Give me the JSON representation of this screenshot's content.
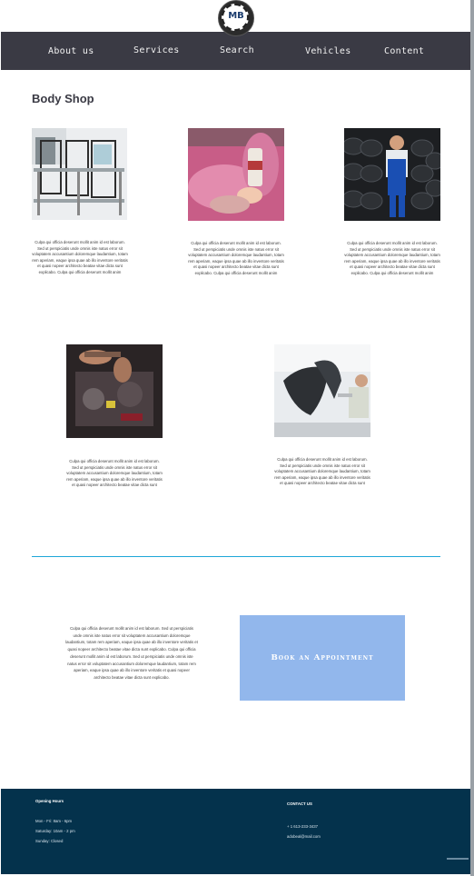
{
  "header": {
    "logo_text": "MB",
    "nav": [
      "About us",
      "Services",
      "Search",
      "Vehicles",
      "Content"
    ]
  },
  "main": {
    "title": "Body Shop",
    "cards": [
      {
        "image": "door-frame-jig",
        "caption": "Culpa qui officia deserunt mollit anim id est laborum. Sed ut perspiciatis unde omnis iste natus error sit voluptatem accusantium doloremque laudantium, totam rem aperiam, eaque ipsa quae ab illo inventore veritatis et quasi nopeer architecto beatae vitae dicta sunt explicabo. Culpa qui officia deserunt mollit anim"
      },
      {
        "image": "pink-car-painting",
        "caption": "Culpa qui officia deserunt mollit anim id est laborum. Sed ut perspiciatis unde omnis iste natus error sit voluptatem accusantium doloremque laudantium, totam rem aperiam, eaque ipsa quae ab illo inventore veritatis et quasi nopeer architecto beatae vitae dicta sunt explicabo. Culpa qui officia deserunt mollit anim"
      },
      {
        "image": "tire-rack-mechanic",
        "caption": "Culpa qui officia deserunt mollit anim id est laborum. Sed ut perspiciatis unde omnis iste natus error sit voluptatem accusantium doloremque laudantium, totam rem aperiam, eaque ipsa quae ab illo inventore veritatis et quasi nopeer architecto beatae vitae dicta sunt explicabo. Culpa qui officia deserunt mollit anim"
      },
      {
        "image": "engine-repair",
        "caption": "Culpa qui officia deserunt mollit anim id est laborum. Sed ut perspiciatis unde omnis iste natus error sit voluptatem accusantium doloremque laudantium, totam rem aperiam, eaque ipsa quae ab illo inventore veritatis et quasi nopeer architecto beatae vitae dicta sunt"
      },
      {
        "image": "bumper-spray",
        "caption": "Culpa qui officia deserunt mollit anim id est laborum. Sed ut perspiciatis unde omnis iste natus error sit voluptatem accusantium doloremque laudantium, totam rem aperiam, eaque ipsa quae ab illo inventore veritatis et quasi nopeer architecto beatae vitae dicta sunt"
      }
    ],
    "booking_text": "Culpa qui officia deserunt mollit anim id est laborum. Sed ut perspiciatis unde omnis iste natus error sit voluptatem accusantium doloremque laudantium, totam rem aperiam, eaque ipsa quae ab illo inventore veritatis et quasi nopeer architecto beatae vitae dicta sunt explicabo. Culpa qui officia deserunt mollit anim id est laborum. Sed ut perspiciatis unde omnis iste natus error sit voluptatem accusantium doloremque laudantium, totam rem aperiam, eaque ipsa quae ab illo inventore veritatis et quasi nopeer architecto beatae vitae dicta sunt explicabo.",
    "booking_button": "Book an Appointment"
  },
  "footer": {
    "hours_title": "Opening Hours",
    "hours": [
      "Mon - Fri: 8am - 6pm",
      "Saturday: 10am - 2 pm",
      "Sunday: Closed"
    ],
    "contact_title": "CONTACT US",
    "phone": "+ 1 613-233-3437",
    "email": "adobeal@mail.com"
  },
  "colors": {
    "nav_bg": "#3a3a44",
    "accent_line": "#1ea7d8",
    "button_bg": "#92b7ec",
    "footer_bg": "#04324c"
  }
}
